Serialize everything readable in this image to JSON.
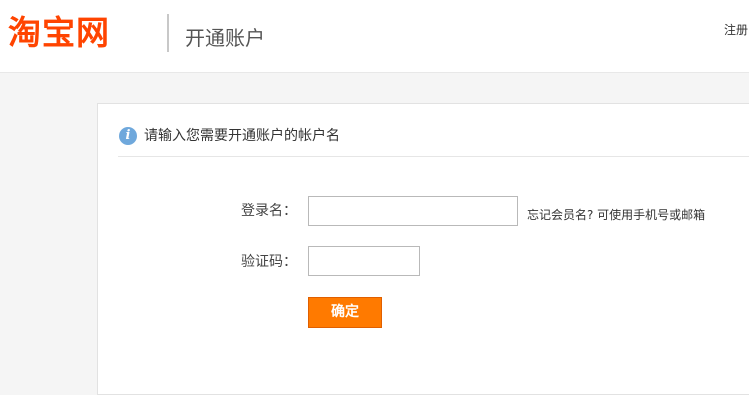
{
  "header": {
    "logo_text": "淘宝网",
    "subtitle": "开通账户",
    "register_link": "注册"
  },
  "panel": {
    "icon": "info-icon",
    "icon_glyph": "i",
    "instruction": "请输入您需要开通账户的帐户名"
  },
  "form": {
    "username_label": "登录名：",
    "username_value": "",
    "hint_link": "忘记会员名? 可使用手机号或邮箱",
    "captcha_label": "验证码：",
    "captcha_value": "",
    "submit_label": "确定"
  },
  "colors": {
    "brand": "#ff4400",
    "button": "#ff7a00",
    "info_icon": "#6fa8dc"
  }
}
